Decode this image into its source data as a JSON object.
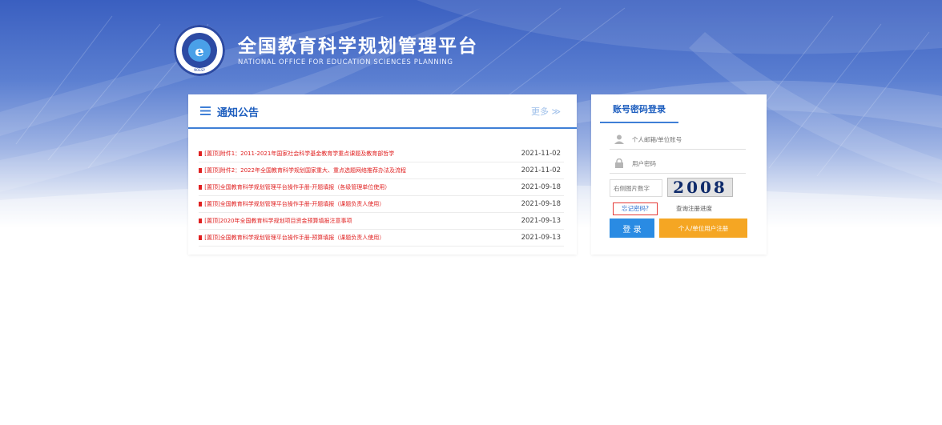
{
  "header": {
    "title": "全国教育科学规划管理平台",
    "subtitle": "NATIONAL OFFICE FOR EDUCATION SCIENCES PLANNING"
  },
  "notice": {
    "title": "通知公告",
    "more": "更多 ≫",
    "items": [
      {
        "title": "[置顶]附件1：2011-2021年国家社会科学基金教育学重点课题及教育部哲学",
        "date": "2021-11-02"
      },
      {
        "title": "[置顶]附件2：2022年全国教育科学规划国家重大、重点选题网络推荐办法及流程",
        "date": "2021-11-02"
      },
      {
        "title": "[置顶]全国教育科学规划管理平台操作手册-开题填报（各级管理单位使用）",
        "date": "2021-09-18"
      },
      {
        "title": "[置顶]全国教育科学规划管理平台操作手册-开题填报（课题负责人使用）",
        "date": "2021-09-18"
      },
      {
        "title": "[置顶]2020年全国教育科学规划项目资金预算填报注意事项",
        "date": "2021-09-13"
      },
      {
        "title": "[置顶]全国教育科学规划管理平台操作手册-预算填报（课题负责人使用）",
        "date": "2021-09-13"
      }
    ]
  },
  "login": {
    "tab": "账号密码登录",
    "username_placeholder": "个人邮箱/单位账号",
    "password_placeholder": "用户密码",
    "captcha_placeholder": "右侧图片数字",
    "captcha_text": "2008",
    "forgot": "忘记密码?",
    "progress": "查询注册进度",
    "login_button": "登 录",
    "register_button": "个人/单位用户注册"
  },
  "colors": {
    "accent": "#1f5fbf",
    "notice_red": "#e02020",
    "login_blue": "#2a8be3",
    "register_orange": "#f5a623"
  }
}
